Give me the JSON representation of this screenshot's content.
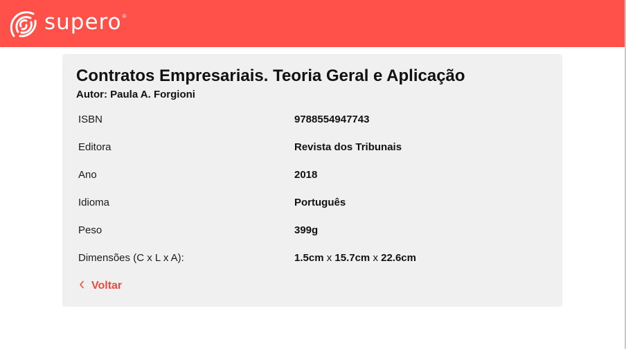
{
  "header": {
    "logo_text": "supero",
    "logo_mark": "®",
    "logo_icon": "signal-waves-icon",
    "background": "#ff5049"
  },
  "book": {
    "title": "Contratos Empresariais. Teoria Geral e Aplicação",
    "author": "Autor: Paula A. Forgioni"
  },
  "details": [
    {
      "label": "ISBN",
      "value": "9788554947743"
    },
    {
      "label": "Editora",
      "value": "Revista dos Tribunais"
    },
    {
      "label": "Ano",
      "value": "2018"
    },
    {
      "label": "Idioma",
      "value": "Português"
    },
    {
      "label": "Peso",
      "value": "399g"
    }
  ],
  "dimensions": {
    "label": "Dimensões (C x L x A):",
    "c": "1.5cm",
    "l": "15.7cm",
    "a": "22.6cm",
    "separator": "x"
  },
  "back": {
    "label": "Voltar",
    "icon": "chevron-left-icon",
    "color": "#f0483f"
  }
}
